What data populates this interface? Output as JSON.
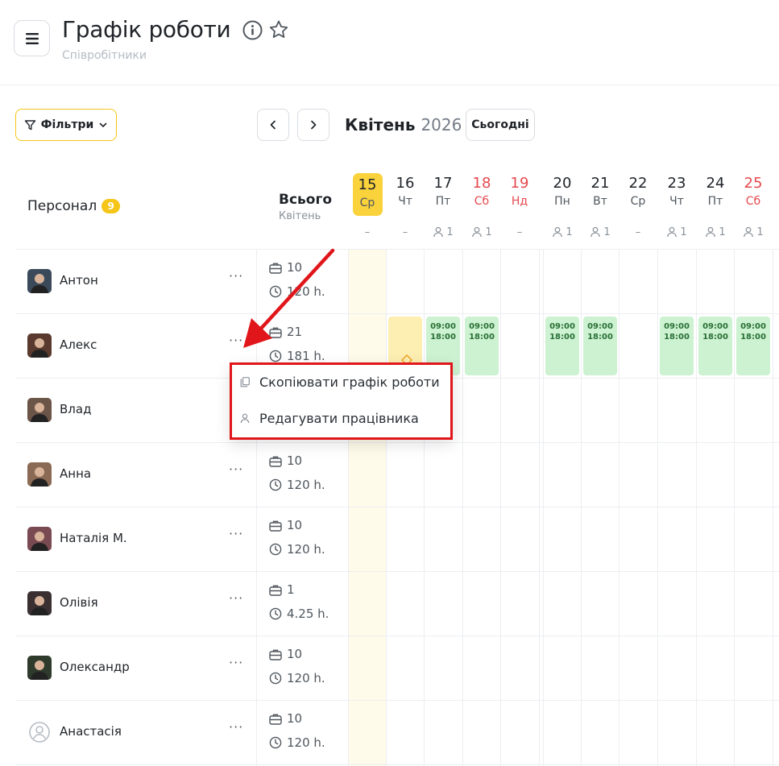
{
  "header": {
    "title": "Графік роботи",
    "subtitle": "Співробітники"
  },
  "toolbar": {
    "filters_label": "Фільтри",
    "month": "Квітень",
    "year": "2026",
    "today_label": "Сьогодні"
  },
  "table": {
    "staff_label": "Персонал",
    "staff_count": "9",
    "total_label": "Всього",
    "total_sub": "Квітень"
  },
  "days": [
    {
      "num": "15",
      "name": "Ср",
      "count": "–"
    },
    {
      "num": "16",
      "name": "Чт",
      "count": "–"
    },
    {
      "num": "17",
      "name": "Пт",
      "count": "1"
    },
    {
      "num": "18",
      "name": "Сб",
      "count": "1"
    },
    {
      "num": "19",
      "name": "Нд",
      "count": "–"
    },
    {
      "num": "20",
      "name": "Пн",
      "count": "1"
    },
    {
      "num": "21",
      "name": "Вт",
      "count": "1"
    },
    {
      "num": "22",
      "name": "Ср",
      "count": "–"
    },
    {
      "num": "23",
      "name": "Чт",
      "count": "1"
    },
    {
      "num": "24",
      "name": "Пт",
      "count": "1"
    },
    {
      "num": "25",
      "name": "Сб",
      "count": "1"
    }
  ],
  "employees": [
    {
      "name": "Антон",
      "shifts": "10",
      "hours": "120 h."
    },
    {
      "name": "Алекс",
      "shifts": "21",
      "hours": "181 h."
    },
    {
      "name": "Влад",
      "shifts": "",
      "hours": ""
    },
    {
      "name": "Анна",
      "shifts": "10",
      "hours": "120 h."
    },
    {
      "name": "Наталія М.",
      "shifts": "10",
      "hours": "120 h."
    },
    {
      "name": "Олівія",
      "shifts": "1",
      "hours": "4.25 h."
    },
    {
      "name": "Олександр",
      "shifts": "10",
      "hours": "120 h."
    },
    {
      "name": "Анастасія",
      "shifts": "10",
      "hours": "120 h."
    }
  ],
  "shift_time": {
    "start": "09:00",
    "end": "18:00"
  },
  "context_menu": {
    "copy_schedule": "Скопіювати графік роботи",
    "edit_employee": "Редагувати працівника"
  },
  "colors": {
    "accent": "#f5c518",
    "shift_green": "#ccf2d1",
    "weekend_red": "#e5484d",
    "highlight_red": "#e0161a"
  }
}
